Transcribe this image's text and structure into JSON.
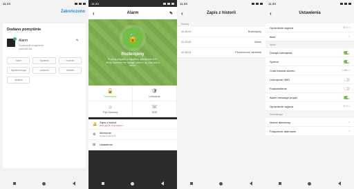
{
  "panel1": {
    "time": "11:44",
    "finish_label": "Zakończono",
    "card_title": "Dodano pomyślnie",
    "device_name": "Alarm",
    "device_status": "Dodawanie urządzenia powiodło się.",
    "rooms": [
      "Salon",
      "Sypialnia",
      "Kuchnia",
      "Sypialnia druga",
      "Łazienka",
      "Gabinet",
      "Jadalnia"
    ]
  },
  "panel2": {
    "time": "11:44",
    "title": "Alarm",
    "status_title": "Rozbrojony",
    "status_desc": "Rozbroj urządzeń z wyjątkiem uzbrojonych 24h. Kiedy zdarzenie nie wystąpi, alarm z czy dnia jest w domu.",
    "actions": [
      {
        "label": "Rozbrojony",
        "icon": "🔓"
      },
      {
        "label": "Uzbrojony",
        "icon": "🛡"
      },
      {
        "label": "Tryb Domowy",
        "icon": "⌂"
      },
      {
        "label": "SOS",
        "icon": "☏"
      }
    ],
    "items": [
      {
        "title": "Zapis z historii",
        "sub": "2021-02-18 11:44 Alarmu",
        "icon": "🔔"
      },
      {
        "title": "Akcesoria",
        "sub": "Dodaj urządzenie",
        "icon": "⚙"
      },
      {
        "title": "Ustawienia",
        "sub": "",
        "icon": "⊞"
      }
    ]
  },
  "panel3": {
    "time": "11:44",
    "title": "Zapis z historii",
    "date_header": "Dzisiaj",
    "rows": [
      {
        "time": "11:43:43",
        "event": "Rozbrojony"
      },
      {
        "time": "11:43:42",
        "event": "Alarm"
      },
      {
        "time": "11:43:41",
        "event": "Przywrócono zasilanie"
      }
    ]
  },
  "panel4": {
    "time": "11:44",
    "title": "Ustawienia",
    "top_rows": [
      {
        "label": "Opóźnienie wyjścia",
        "value": "60 S >"
      },
      {
        "label": "timer",
        "value": ">"
      }
    ],
    "section_alarm": "Alarm",
    "alarm_rows": [
      {
        "label": "Dźwięk uzbrojenia",
        "toggle": true
      },
      {
        "label": "Syrena",
        "toggle": true
      },
      {
        "label": "Czas trwania alarmu",
        "value": "3 Min >"
      },
      {
        "label": "Uzbrojenie SMS",
        "toggle": false
      },
      {
        "label": "Podświetlenie",
        "toggle": false
      },
      {
        "label": "Alarm message propel",
        "toggle": true
      },
      {
        "label": "Opóźnienie wyjścia",
        "value": "30 S >"
      }
    ],
    "section_comm": "Komunikacja",
    "comm_rows": [
      {
        "label": "Numer alarmowy",
        "value": ">"
      },
      {
        "label": "Połączenie alarmowe",
        "value": ">"
      }
    ]
  }
}
